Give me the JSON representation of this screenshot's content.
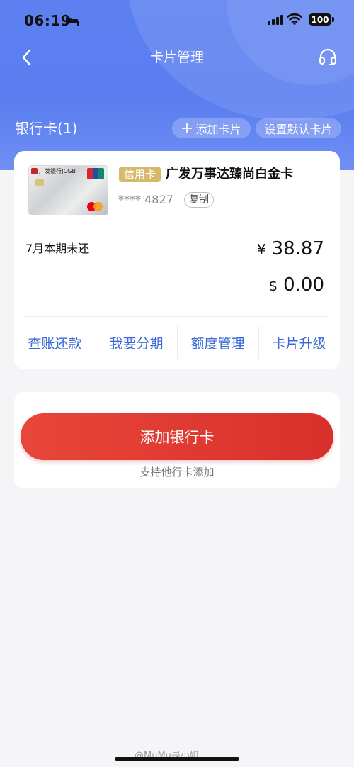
{
  "status_bar": {
    "time": "06:19",
    "battery": "100"
  },
  "nav": {
    "title": "卡片管理"
  },
  "cards_header": {
    "count_label": "银行卡(1)",
    "add_card_label": "添加卡片",
    "set_default_label": "设置默认卡片"
  },
  "card": {
    "bank_mark": "广发银行|CGB",
    "type_badge": "信用卡",
    "name": "广发万事达臻尚白金卡",
    "masked_number": "**** 4827",
    "copy_label": "复制",
    "due_label": "7月本期未还",
    "amount_cny_symbol": "¥",
    "amount_cny": "38.87",
    "amount_usd_symbol": "$",
    "amount_usd": "0.00",
    "actions": [
      "查账还款",
      "我要分期",
      "额度管理",
      "卡片升级"
    ]
  },
  "add_bank": {
    "button_label": "添加银行卡",
    "hint": "支持他行卡添加"
  },
  "watermark": "@MuMu是小姐",
  "colors": {
    "header_blue": "#5c80f0",
    "action_blue": "#3a6ad6",
    "add_button_red": "#e0392f",
    "badge_gold": "#d8b86a"
  }
}
